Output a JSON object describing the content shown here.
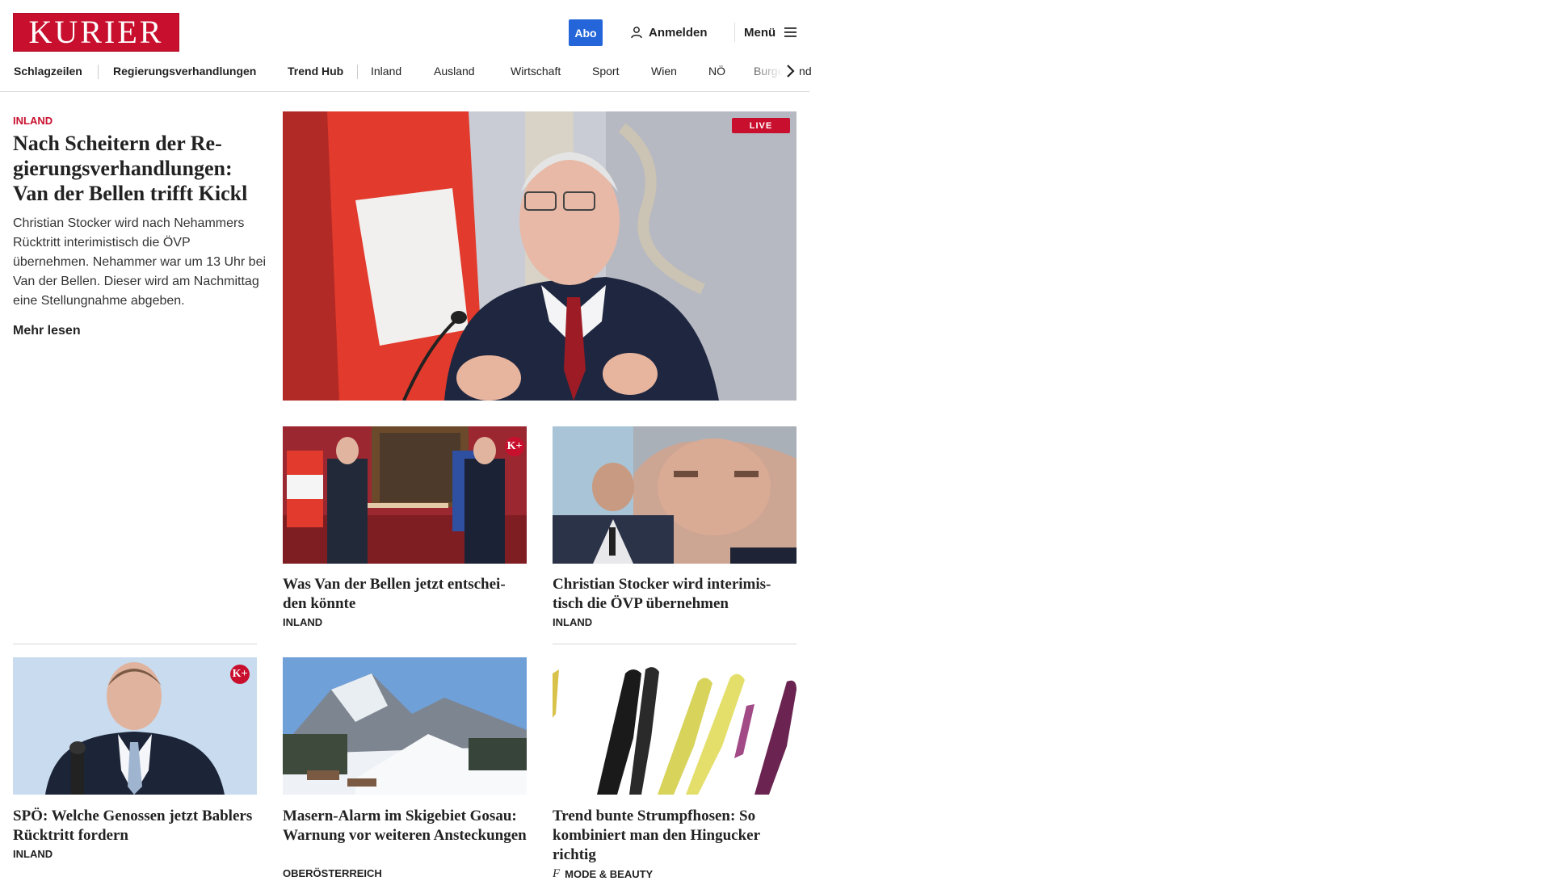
{
  "header": {
    "logo_text": "KURIER",
    "abo_label": "Abo",
    "login_label": "Anmelden",
    "menu_label": "Menü",
    "brand_color": "#c8102e",
    "abo_color": "#2466d9"
  },
  "nav": {
    "items": [
      {
        "label": "Schlagzeilen"
      },
      {
        "label": "Regierungsverhandlungen"
      },
      {
        "label": "Trend Hub"
      },
      {
        "label": "Inland"
      },
      {
        "label": "Ausland"
      },
      {
        "label": "Wirtschaft"
      },
      {
        "label": "Sport"
      },
      {
        "label": "Wien"
      },
      {
        "label": "NÖ"
      },
      {
        "label": "Burgenland"
      }
    ],
    "next_icon": "chevron-right-icon"
  },
  "lead": {
    "kicker": "INLAND",
    "title": "Nach Scheitern der Re-gierungsverhandlungen: Van der Bellen trifft Kickl",
    "teaser": "Christian Stocker wird nach Nehammers Rücktritt interimistisch die ÖVP übernehmen. Nehammer war um 13 Uhr bei Van der Bellen. Dieser wird am Nachmittag eine Stellungnahme abgeben.",
    "more_label": "Mehr lesen",
    "live_badge": "LIVE"
  },
  "cards": [
    {
      "title": "Was Van der Bellen jetzt entschei-den könnte",
      "category": "INLAND",
      "plus_badge": "K+"
    },
    {
      "title": "Christian Stocker wird interimis-tisch die ÖVP übernehmen",
      "category": "INLAND"
    },
    {
      "title": "SPÖ: Welche Genossen jetzt Bablers Rücktritt fordern",
      "category": "INLAND",
      "plus_badge": "K+"
    },
    {
      "title": "Masern-Alarm im Skigebiet Gosau: Warnung vor weiteren Ansteckungen",
      "category": "OBERÖSTERREICH"
    },
    {
      "title": "Trend bunte Strumpfhosen: So kombiniert man den Hingucker richtig",
      "category": "MODE & BEAUTY",
      "category_icon": "f-icon"
    }
  ]
}
